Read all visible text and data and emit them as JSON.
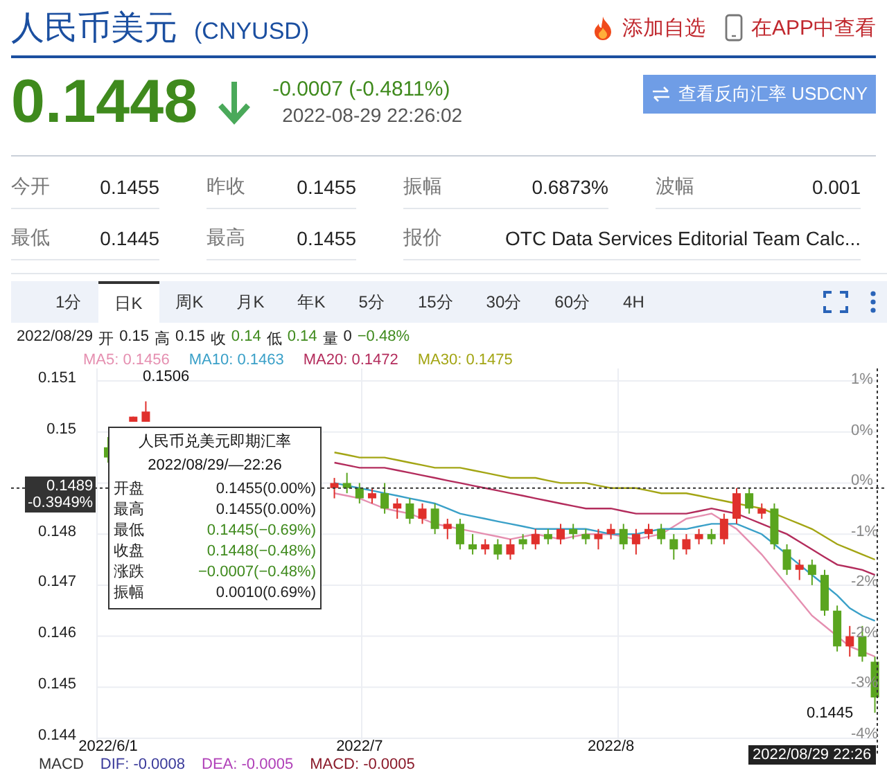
{
  "header": {
    "title": "人民币美元",
    "code": "(CNYUSD)",
    "actions": [
      {
        "kind": "watchlist",
        "label": "添加自选"
      },
      {
        "kind": "app",
        "label": "在APP中查看"
      }
    ]
  },
  "quote": {
    "price": "0.1448",
    "falling": true,
    "change": "-0.0007 (-0.4811%)",
    "time": "2022-08-29 22:26:02",
    "reverse_button": "查看反向汇率 USDCNY"
  },
  "stats": [
    [
      {
        "label": "今开",
        "value": "0.1455"
      },
      {
        "label": "昨收",
        "value": "0.1455"
      },
      {
        "label": "振幅",
        "value": "0.6873%"
      },
      {
        "label": "波幅",
        "value": "0.001"
      }
    ],
    [
      {
        "label": "最低",
        "value": "0.1445"
      },
      {
        "label": "最高",
        "value": "0.1455"
      },
      {
        "label": "报价",
        "value": "OTC Data Services Editorial Team Calc..."
      }
    ]
  ],
  "chart": {
    "tabs": [
      {
        "label": "1分",
        "selected": false
      },
      {
        "label": "日K",
        "selected": true
      },
      {
        "label": "周K",
        "selected": false
      },
      {
        "label": "月K",
        "selected": false
      },
      {
        "label": "年K",
        "selected": false
      },
      {
        "label": "5分",
        "selected": false
      },
      {
        "label": "15分",
        "selected": false
      },
      {
        "label": "30分",
        "selected": false
      },
      {
        "label": "60分",
        "selected": false
      },
      {
        "label": "4H",
        "selected": false
      }
    ],
    "info": {
      "date": "2022/08/29",
      "items": [
        {
          "label": "开",
          "value": "0.15",
          "color": "#222222"
        },
        {
          "label": "高",
          "value": "0.15",
          "color": "#222222"
        },
        {
          "label": "收",
          "value": "0.14",
          "color": "#3f8a1d"
        },
        {
          "label": "低",
          "value": "0.14",
          "color": "#3f8a1d"
        },
        {
          "label": "量",
          "value": "0",
          "color": "#222222"
        },
        {
          "value": "−0.48%",
          "color": "#3f8a1d"
        }
      ]
    },
    "chart_data": {
      "type": "candlestick",
      "categories": [
        "2022/6/1",
        null,
        null,
        null,
        null,
        null,
        null,
        null,
        null,
        null,
        null,
        null,
        null,
        null,
        null,
        null,
        null,
        null,
        null,
        null,
        "2022/7",
        null,
        null,
        null,
        null,
        null,
        null,
        null,
        null,
        null,
        null,
        null,
        null,
        null,
        null,
        null,
        null,
        null,
        null,
        null,
        "2022/8",
        null,
        null,
        null,
        null,
        null,
        null,
        null,
        null,
        null,
        null,
        null,
        null,
        null,
        null,
        null,
        null,
        null,
        null,
        null,
        null,
        null
      ],
      "ylim": [
        0.144,
        0.151
      ],
      "yticks": [
        0.151,
        0.15,
        0.148,
        0.147,
        0.146,
        0.145,
        0.144
      ],
      "grid": true,
      "ref_lines": [
        {
          "axis": "y",
          "value": 0.1489
        }
      ],
      "ohlc": [
        [
          0.1497,
          0.1499,
          0.1494,
          0.1495
        ],
        null,
        [
          0.1502,
          0.1503,
          0.1502,
          0.1503
        ],
        [
          0.1502,
          0.1506,
          0.1502,
          0.1504
        ],
        null,
        null,
        null,
        null,
        null,
        null,
        null,
        null,
        null,
        null,
        null,
        null,
        null,
        null,
        [
          0.1489,
          0.1491,
          0.1487,
          0.149
        ],
        [
          0.149,
          0.1492,
          0.1488,
          0.1489
        ],
        [
          0.1489,
          0.149,
          0.1486,
          0.1487
        ],
        [
          0.1487,
          0.1489,
          0.1486,
          0.1488
        ],
        [
          0.1488,
          0.149,
          0.1484,
          0.1485
        ],
        [
          0.1485,
          0.1487,
          0.1483,
          0.1486
        ],
        [
          0.1486,
          0.1487,
          0.1482,
          0.1483
        ],
        [
          0.1483,
          0.1486,
          0.1482,
          0.1485
        ],
        [
          0.1485,
          0.1486,
          0.148,
          0.1481
        ],
        [
          0.1481,
          0.1483,
          0.1479,
          0.1482
        ],
        [
          0.1482,
          0.1483,
          0.1477,
          0.1478
        ],
        [
          0.1478,
          0.148,
          0.1476,
          0.1477
        ],
        [
          0.1477,
          0.1479,
          0.1476,
          0.1478
        ],
        [
          0.1478,
          0.1479,
          0.1475,
          0.1476
        ],
        [
          0.1476,
          0.1479,
          0.1475,
          0.1478
        ],
        [
          0.1479,
          0.148,
          0.1477,
          0.1478
        ],
        [
          0.1478,
          0.1481,
          0.1477,
          0.148
        ],
        [
          0.148,
          0.1481,
          0.1478,
          0.1479
        ],
        [
          0.1479,
          0.1482,
          0.1478,
          0.1481
        ],
        [
          0.1481,
          0.1482,
          0.1479,
          0.148
        ],
        [
          0.148,
          0.1481,
          0.1478,
          0.1479
        ],
        [
          0.1479,
          0.1481,
          0.1477,
          0.148
        ],
        [
          0.148,
          0.1482,
          0.1479,
          0.1481
        ],
        [
          0.1481,
          0.1482,
          0.1477,
          0.1478
        ],
        [
          0.1478,
          0.1481,
          0.1476,
          0.148
        ],
        [
          0.148,
          0.1482,
          0.1479,
          0.1481
        ],
        [
          0.1481,
          0.1482,
          0.1478,
          0.1479
        ],
        [
          0.1479,
          0.148,
          0.1475,
          0.1477
        ],
        [
          0.1477,
          0.148,
          0.1476,
          0.1479
        ],
        [
          0.1479,
          0.1481,
          0.1478,
          0.148
        ],
        [
          0.148,
          0.1481,
          0.1478,
          0.1479
        ],
        [
          0.1479,
          0.1484,
          0.1478,
          0.1483
        ],
        [
          0.1483,
          0.1489,
          0.1482,
          0.1488
        ],
        [
          0.1488,
          0.1489,
          0.1484,
          0.1485
        ],
        [
          0.1484,
          0.1486,
          0.1483,
          0.1485
        ],
        [
          0.1485,
          0.1486,
          0.1477,
          0.1478
        ],
        [
          0.1477,
          0.1478,
          0.1472,
          0.1473
        ],
        [
          0.1473,
          0.1475,
          0.1471,
          0.1474
        ],
        [
          0.1474,
          0.1475,
          0.147,
          0.1472
        ],
        [
          0.1472,
          0.1473,
          0.1464,
          0.1465
        ],
        [
          0.1465,
          0.1466,
          0.1457,
          0.1458
        ],
        [
          0.1458,
          0.1462,
          0.1456,
          0.146
        ],
        [
          0.146,
          0.1462,
          0.1455,
          0.1456
        ],
        [
          0.1455,
          0.1456,
          0.1445,
          0.1448
        ]
      ],
      "series": [
        {
          "name": "MA5: 0.1456",
          "type": "line",
          "color": "#e58fb0",
          "values": [
            null,
            null,
            null,
            null,
            null,
            null,
            null,
            null,
            null,
            null,
            null,
            null,
            null,
            null,
            null,
            null,
            null,
            null,
            0.1488,
            0.14875,
            0.1487,
            0.1486,
            0.1485,
            0.14845,
            0.1484,
            0.1483,
            0.1482,
            0.14815,
            0.1481,
            0.14805,
            0.148,
            0.14795,
            0.1479,
            0.14795,
            0.148,
            0.14795,
            0.1479,
            0.14795,
            0.148,
            0.148,
            0.148,
            0.14795,
            0.1479,
            0.14795,
            0.148,
            0.14815,
            0.1483,
            0.14835,
            0.1484,
            0.14825,
            0.1481,
            0.14785,
            0.1476,
            0.1473,
            0.147,
            0.1467,
            0.1464,
            0.1462,
            0.146,
            0.1458,
            0.1457,
            0.1456
          ]
        },
        {
          "name": "MA10: 0.1463",
          "type": "line",
          "color": "#3aa0c8",
          "values": [
            null,
            null,
            null,
            null,
            null,
            null,
            null,
            null,
            null,
            null,
            null,
            null,
            null,
            null,
            null,
            null,
            null,
            null,
            0.149,
            0.14895,
            0.1489,
            0.14885,
            0.1488,
            0.14875,
            0.1487,
            0.14865,
            0.1486,
            0.1485,
            0.1484,
            0.14835,
            0.1483,
            0.14825,
            0.1482,
            0.14815,
            0.1481,
            0.1481,
            0.1481,
            0.1481,
            0.1481,
            0.14805,
            0.148,
            0.148,
            0.148,
            0.14805,
            0.1481,
            0.1481,
            0.1481,
            0.14815,
            0.1482,
            0.1482,
            0.1482,
            0.1481,
            0.148,
            0.1478,
            0.1476,
            0.1474,
            0.1472,
            0.147,
            0.1468,
            0.14655,
            0.1464,
            0.1463
          ]
        },
        {
          "name": "MA20: 0.1472",
          "type": "line",
          "color": "#b32c5c",
          "values": [
            null,
            null,
            null,
            null,
            null,
            null,
            null,
            null,
            null,
            null,
            null,
            null,
            null,
            null,
            null,
            null,
            null,
            null,
            0.1494,
            0.14935,
            0.1493,
            0.1493,
            0.1493,
            0.14925,
            0.1492,
            0.14915,
            0.1491,
            0.14905,
            0.149,
            0.14895,
            0.1489,
            0.14885,
            0.1488,
            0.14875,
            0.1487,
            0.14865,
            0.1486,
            0.14855,
            0.1485,
            0.1485,
            0.1485,
            0.14845,
            0.1484,
            0.1484,
            0.1484,
            0.1484,
            0.1484,
            0.14845,
            0.1485,
            0.14845,
            0.1484,
            0.1483,
            0.1482,
            0.1481,
            0.148,
            0.14785,
            0.1477,
            0.14755,
            0.1474,
            0.14735,
            0.1473,
            0.1472
          ]
        },
        {
          "name": "MA30: 0.1475",
          "type": "line",
          "color": "#a3a514",
          "values": [
            null,
            null,
            null,
            null,
            null,
            null,
            null,
            null,
            null,
            null,
            null,
            null,
            null,
            null,
            null,
            null,
            null,
            null,
            0.1496,
            0.14955,
            0.1495,
            0.1495,
            0.1495,
            0.14945,
            0.1494,
            0.14935,
            0.1493,
            0.1493,
            0.1493,
            0.14925,
            0.1492,
            0.14915,
            0.1491,
            0.1491,
            0.1491,
            0.14905,
            0.149,
            0.149,
            0.149,
            0.14895,
            0.1489,
            0.1489,
            0.1489,
            0.14885,
            0.1488,
            0.1488,
            0.1488,
            0.14875,
            0.1487,
            0.14865,
            0.1486,
            0.14855,
            0.1485,
            0.1484,
            0.1483,
            0.1482,
            0.1481,
            0.14795,
            0.1478,
            0.1477,
            0.1476,
            0.1475
          ]
        }
      ]
    },
    "right_ticks": [
      "1%",
      "0%",
      "0%",
      "-1%",
      "-2%",
      "-2%",
      "-3%",
      "-4%"
    ],
    "peak_label": "0.1506",
    "crosshair": {
      "price": "0.1489",
      "percent": "-0.3949%"
    },
    "last": {
      "price": "0.1445",
      "date": "2022/08/29 22:26"
    },
    "tooltip": {
      "title": "人民币兑美元即期汇率",
      "date": "2022/08/29/—22:26",
      "rows": [
        {
          "label": "开盘",
          "value": "0.1455(0.00%)",
          "color": "#222222"
        },
        {
          "label": "最高",
          "value": "0.1455(0.00%)",
          "color": "#222222"
        },
        {
          "label": "最低",
          "value": "0.1445(−0.69%)",
          "color": "#3f8a1d"
        },
        {
          "label": "收盘",
          "value": "0.1448(−0.48%)",
          "color": "#3f8a1d"
        },
        {
          "label": "涨跌",
          "value": "−0.0007(−0.48%)",
          "color": "#3f8a1d"
        },
        {
          "label": "振幅",
          "value": "0.0010(0.69%)",
          "color": "#222222"
        }
      ]
    },
    "macd": {
      "label": "MACD",
      "items": [
        {
          "label": "DIF: -0.0008",
          "color": "#3a3a9a"
        },
        {
          "label": "DEA: -0.0005",
          "color": "#b040b8"
        },
        {
          "label": "MACD: -0.0005",
          "color": "#8a1a2a"
        }
      ]
    }
  }
}
